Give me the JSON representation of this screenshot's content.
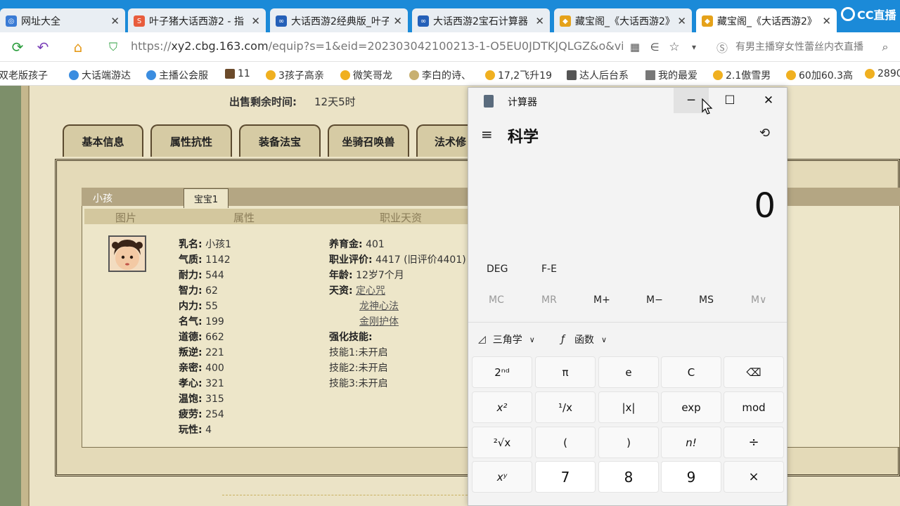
{
  "browser": {
    "tabs": [
      {
        "title": "网址大全",
        "icon": "globe-icon",
        "color": "#3a7bd5"
      },
      {
        "title": "叶子猪大话西游2 - 指",
        "icon": "s-logo-icon",
        "color": "#e85c3c"
      },
      {
        "title": "大话西游2经典版_叶子",
        "icon": "game-logo-icon",
        "color": "#2560b8"
      },
      {
        "title": "大话西游2宝石计算器",
        "icon": "game-logo-icon",
        "color": "#2560b8"
      },
      {
        "title": "藏宝阁_《大话西游2》",
        "icon": "treasure-icon",
        "color": "#e5a21a"
      },
      {
        "title": "藏宝阁_《大话西游2》",
        "icon": "treasure-icon",
        "color": "#e5a21a"
      }
    ],
    "brand": "CC直播",
    "url_scheme": "https://",
    "url_host": "xy2.cbg.163.com",
    "url_path": "/equip?s=1&eid=202303042100213-1-O5EU0JDTKJQLGZ&o&vie",
    "search_placeholder": "有男主播穿女性蕾丝内衣直播",
    "bookmarks": [
      "双老版孩子",
      "大话端游达",
      "主播公会服",
      "11",
      "3孩子高亲",
      "微笑哥龙",
      "李白的诗、",
      "17,2飞升19",
      "达人后台系",
      "我的最爱",
      "2.1傲雪男",
      "60加60.3高",
      "2890"
    ]
  },
  "page": {
    "time_label": "出售剩余时间:",
    "time_value": "12天5时",
    "section_tabs": [
      "基本信息",
      "属性抗性",
      "装备法宝",
      "坐骑召唤兽",
      "法术修"
    ],
    "kid_name": "小孩",
    "sub_tab": "宝宝1",
    "col_headers": [
      "图片",
      "属性",
      "职业天资"
    ],
    "attrs_left": [
      {
        "k": "乳名:",
        "v": "小孩1"
      },
      {
        "k": "气质:",
        "v": "1142"
      },
      {
        "k": "耐力:",
        "v": "544"
      },
      {
        "k": "智力:",
        "v": "62"
      },
      {
        "k": "内力:",
        "v": "55"
      },
      {
        "k": "名气:",
        "v": "199"
      },
      {
        "k": "道德:",
        "v": "662"
      },
      {
        "k": "叛逆:",
        "v": "221"
      },
      {
        "k": "亲密:",
        "v": "400"
      },
      {
        "k": "孝心:",
        "v": "321"
      },
      {
        "k": "温饱:",
        "v": "315"
      },
      {
        "k": "疲劳:",
        "v": "254"
      },
      {
        "k": "玩性:",
        "v": "4"
      }
    ],
    "attrs_right": [
      {
        "k": "养育金:",
        "v": "401"
      },
      {
        "k": "职业评价:",
        "v": "4417 (旧评价4401)"
      },
      {
        "k": "年龄:",
        "v": "12岁7个月"
      },
      {
        "k": "天资:",
        "v": "定心咒"
      }
    ],
    "talents_extra": [
      "龙神心法",
      "金刚护体"
    ],
    "skills_label": "强化技能:",
    "skills": [
      {
        "k": "技能1:",
        "v": "未开启"
      },
      {
        "k": "技能2:",
        "v": "未开启"
      },
      {
        "k": "技能3:",
        "v": "未开启"
      }
    ]
  },
  "calculator": {
    "title": "计算器",
    "mode": "科学",
    "display": "0",
    "angle": [
      "DEG",
      "F-E"
    ],
    "memory": [
      "MC",
      "MR",
      "M+",
      "M−",
      "MS",
      "M∨"
    ],
    "trig_label": "三角学",
    "func_label": "函数",
    "buttons": [
      [
        "2ⁿᵈ",
        "π",
        "e",
        "C",
        "⌫"
      ],
      [
        "x²",
        "¹/x",
        "|x|",
        "exp",
        "mod"
      ],
      [
        "²√x",
        "(",
        ")",
        "n!",
        "÷"
      ],
      [
        "xʸ",
        "7",
        "8",
        "9",
        "×"
      ]
    ]
  }
}
